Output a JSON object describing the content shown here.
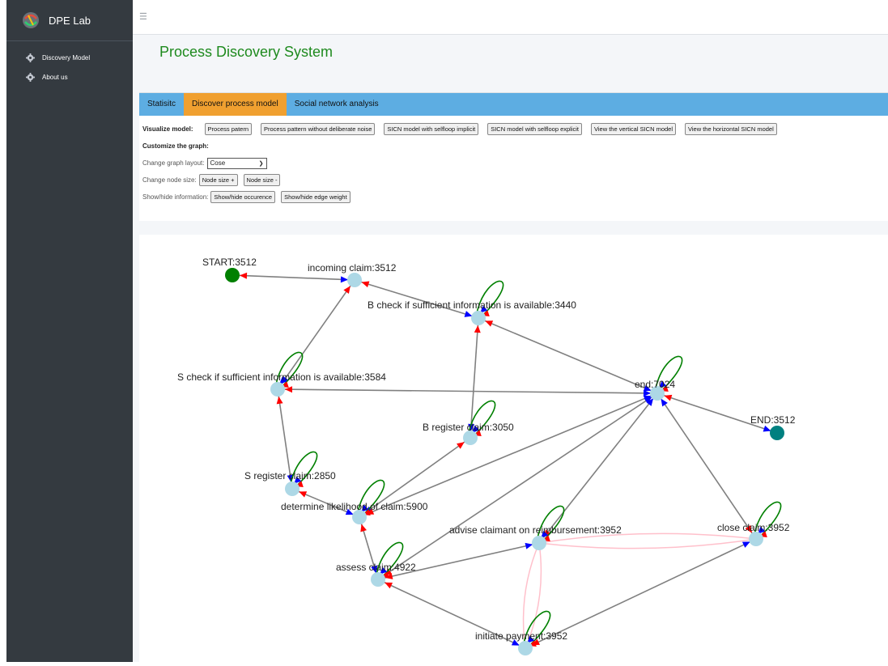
{
  "sidebar": {
    "brand": "DPE Lab",
    "items": [
      {
        "label": "Discovery Model",
        "icon": "gear-icon"
      },
      {
        "label": "About us",
        "icon": "gear-icon"
      }
    ]
  },
  "topbar": {
    "menu_icon": "hamburger-icon"
  },
  "header": {
    "title": "Process Discovery System"
  },
  "tabs": [
    {
      "label": "Statisitc",
      "active": false
    },
    {
      "label": "Discover process model",
      "active": true
    },
    {
      "label": "Social network analysis",
      "active": false
    }
  ],
  "controls": {
    "visualize_label": "Visualize model:",
    "visualize_buttons": [
      "Process patern",
      "Process pattern without deliberate noise",
      "SICN model with selfloop implicit",
      "SICN model with selfloop explicit",
      "View the vertical SICN model",
      "View the horizontal SICN model"
    ],
    "customize_label": "Customize the graph:",
    "layout_label": "Change graph layout:",
    "layout_value": "Cose",
    "node_size_label": "Change node size:",
    "node_size_plus": "Node size +",
    "node_size_minus": "Node size -",
    "show_label": "Show/hide information:",
    "show_occurence": "Show/hide occurence",
    "show_edge_weight": "Show/hide edge weight"
  },
  "graph": {
    "colors": {
      "node": "#add8e6",
      "start": "#008000",
      "end": "#008080",
      "edge": "#808080",
      "arrow_in": "#0000ff",
      "arrow_out": "#ff0000",
      "selfloop": "#008000",
      "pink_edge": "#ffc0cb"
    },
    "nodes": [
      {
        "id": "start",
        "label": "START:3512",
        "type": "start"
      },
      {
        "id": "inc",
        "label": "incoming claim:3512",
        "type": "task",
        "selfloop": false
      },
      {
        "id": "bcheck",
        "label": "B check if sufficient information is available:3440",
        "type": "task",
        "selfloop": true
      },
      {
        "id": "scheck",
        "label": "S check if sufficient information is available:3584",
        "type": "task",
        "selfloop": true
      },
      {
        "id": "endn",
        "label": "end:7024",
        "type": "task",
        "selfloop": true
      },
      {
        "id": "END",
        "label": "END:3512",
        "type": "end"
      },
      {
        "id": "breg",
        "label": "B register claim:3050",
        "type": "task",
        "selfloop": true
      },
      {
        "id": "sreg",
        "label": "S register claim:2850",
        "type": "task",
        "selfloop": true
      },
      {
        "id": "det",
        "label": "determine likelihood of claim:5900",
        "type": "task",
        "selfloop": true
      },
      {
        "id": "adv",
        "label": "advise claimant on reimbursement:3952",
        "type": "task",
        "selfloop": true
      },
      {
        "id": "close",
        "label": "close claim:3952",
        "type": "task",
        "selfloop": true
      },
      {
        "id": "assess",
        "label": "assess claim:4922",
        "type": "task",
        "selfloop": true
      },
      {
        "id": "init",
        "label": "initiate payment:3952",
        "type": "task",
        "selfloop": true
      }
    ],
    "edges": [
      {
        "from": "start",
        "to": "inc"
      },
      {
        "from": "inc",
        "to": "bcheck"
      },
      {
        "from": "inc",
        "to": "scheck"
      },
      {
        "from": "bcheck",
        "to": "breg"
      },
      {
        "from": "bcheck",
        "to": "endn"
      },
      {
        "from": "scheck",
        "to": "endn"
      },
      {
        "from": "scheck",
        "to": "sreg"
      },
      {
        "from": "breg",
        "to": "det"
      },
      {
        "from": "sreg",
        "to": "det"
      },
      {
        "from": "det",
        "to": "endn"
      },
      {
        "from": "det",
        "to": "assess"
      },
      {
        "from": "assess",
        "to": "endn"
      },
      {
        "from": "assess",
        "to": "adv"
      },
      {
        "from": "assess",
        "to": "init"
      },
      {
        "from": "adv",
        "to": "endn"
      },
      {
        "from": "init",
        "to": "close"
      },
      {
        "from": "close",
        "to": "endn"
      },
      {
        "from": "endn",
        "to": "END"
      },
      {
        "from": "adv",
        "to": "close",
        "style": "pink"
      },
      {
        "from": "close",
        "to": "adv",
        "style": "pink"
      },
      {
        "from": "adv",
        "to": "init",
        "style": "pink"
      },
      {
        "from": "init",
        "to": "adv",
        "style": "pink"
      }
    ]
  }
}
